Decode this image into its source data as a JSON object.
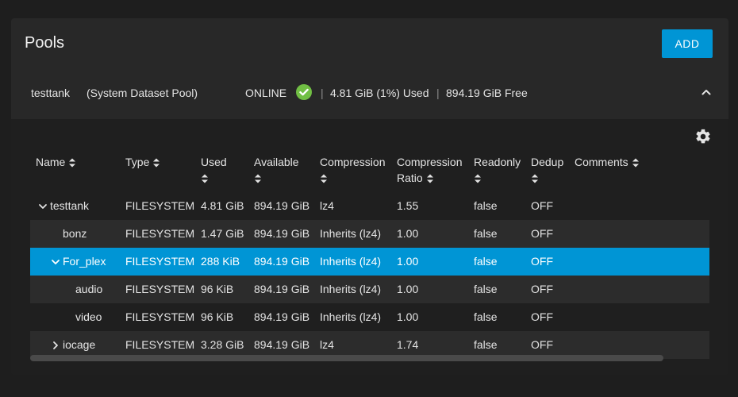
{
  "card": {
    "title": "Pools",
    "add_label": "ADD"
  },
  "pool": {
    "name": "testtank",
    "desc": "(System Dataset Pool)",
    "status": "ONLINE",
    "used": "4.81 GiB (1%) Used",
    "free": "894.19 GiB Free",
    "separator": "|"
  },
  "icons": {
    "status": "check-circle-icon",
    "collapse": "chevron-up-icon",
    "settings": "gear-icon",
    "sort": "sort-icon",
    "expand_open": "chevron-down-icon",
    "expand_closed": "chevron-right-icon"
  },
  "colors": {
    "accent": "#0095d5",
    "online": "#71bf44"
  },
  "table": {
    "headers": {
      "name": "Name",
      "type": "Type",
      "used": "Used",
      "available": "Available",
      "compression": "Compression",
      "ratio_line1": "Compression",
      "ratio_line2": "Ratio",
      "readonly": "Readonly",
      "dedup": "Dedup",
      "comments": "Comments"
    },
    "rows": [
      {
        "name": "testtank",
        "type": "FILESYSTEM",
        "used": "4.81 GiB",
        "available": "894.19 GiB",
        "compression": "lz4",
        "ratio": "1.55",
        "readonly": "false",
        "dedup": "OFF"
      },
      {
        "name": "bonz",
        "type": "FILESYSTEM",
        "used": "1.47 GiB",
        "available": "894.19 GiB",
        "compression": "Inherits (lz4)",
        "ratio": "1.00",
        "readonly": "false",
        "dedup": "OFF"
      },
      {
        "name": "For_plex",
        "type": "FILESYSTEM",
        "used": "288 KiB",
        "available": "894.19 GiB",
        "compression": "Inherits (lz4)",
        "ratio": "1.00",
        "readonly": "false",
        "dedup": "OFF"
      },
      {
        "name": "audio",
        "type": "FILESYSTEM",
        "used": "96 KiB",
        "available": "894.19 GiB",
        "compression": "Inherits (lz4)",
        "ratio": "1.00",
        "readonly": "false",
        "dedup": "OFF"
      },
      {
        "name": "video",
        "type": "FILESYSTEM",
        "used": "96 KiB",
        "available": "894.19 GiB",
        "compression": "Inherits (lz4)",
        "ratio": "1.00",
        "readonly": "false",
        "dedup": "OFF"
      },
      {
        "name": "iocage",
        "type": "FILESYSTEM",
        "used": "3.28 GiB",
        "available": "894.19 GiB",
        "compression": "lz4",
        "ratio": "1.74",
        "readonly": "false",
        "dedup": "OFF"
      }
    ]
  }
}
